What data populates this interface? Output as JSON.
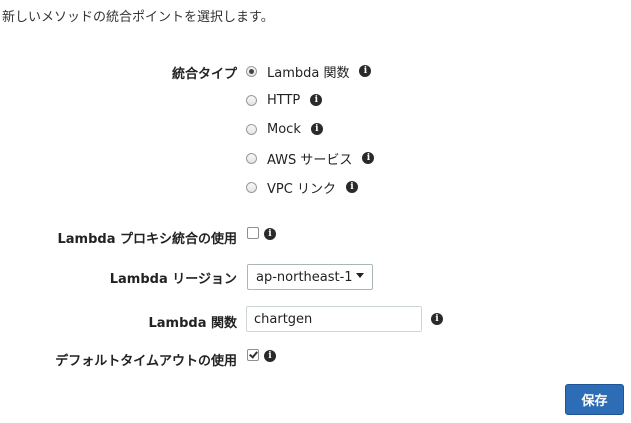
{
  "intro_text": "新しいメソッドの統合ポイントを選択します。",
  "integration_type": {
    "label": "統合タイプ",
    "options": [
      {
        "label": "Lambda 関数",
        "selected": true
      },
      {
        "label": "HTTP",
        "selected": false
      },
      {
        "label": "Mock",
        "selected": false
      },
      {
        "label": "AWS サービス",
        "selected": false
      },
      {
        "label": "VPC リンク",
        "selected": false
      }
    ]
  },
  "proxy": {
    "label": "Lambda プロキシ統合の使用",
    "checked": false
  },
  "region": {
    "label": "Lambda リージョン",
    "value": "ap-northeast-1"
  },
  "function": {
    "label": "Lambda 関数",
    "value": "chartgen"
  },
  "default_timeout": {
    "label": "デフォルトタイムアウトの使用",
    "checked": true
  },
  "save_label": "保存",
  "info_glyph": "i",
  "colors": {
    "primary_button": "#2d6db5"
  }
}
